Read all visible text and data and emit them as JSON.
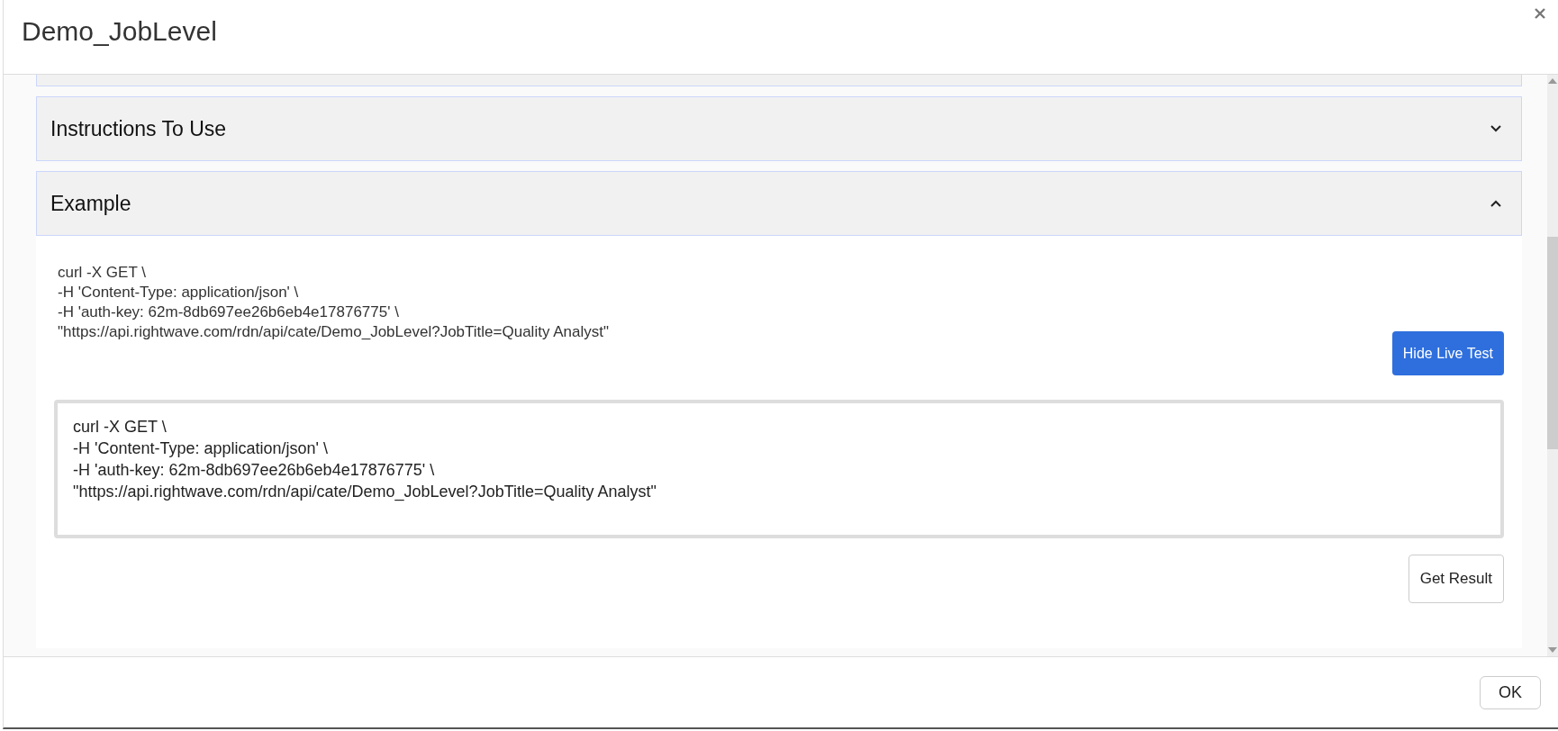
{
  "dialog": {
    "title": "Demo_JobLevel"
  },
  "sections": [
    {
      "title": "Instructions To Use",
      "expanded": false
    },
    {
      "title": "Example",
      "expanded": true
    }
  ],
  "example": {
    "code_lines": [
      "curl -X GET \\",
      "-H 'Content-Type: application/json' \\",
      "-H 'auth-key: 62m-8db697ee26b6eb4e17876775' \\",
      "\"https://api.rightwave.com/rdn/api/cate/Demo_JobLevel?JobTitle=Quality Analyst\""
    ],
    "live_test_button": "Hide Live Test",
    "request_input": [
      "curl -X GET \\",
      "-H 'Content-Type: application/json' \\",
      "-H 'auth-key: 62m-8db697ee26b6eb4e17876775' \\",
      "\"https://api.rightwave.com/rdn/api/cate/Demo_JobLevel?JobTitle=Quality Analyst\""
    ],
    "result_button": "Get Result"
  },
  "footer": {
    "ok_button": "OK"
  }
}
